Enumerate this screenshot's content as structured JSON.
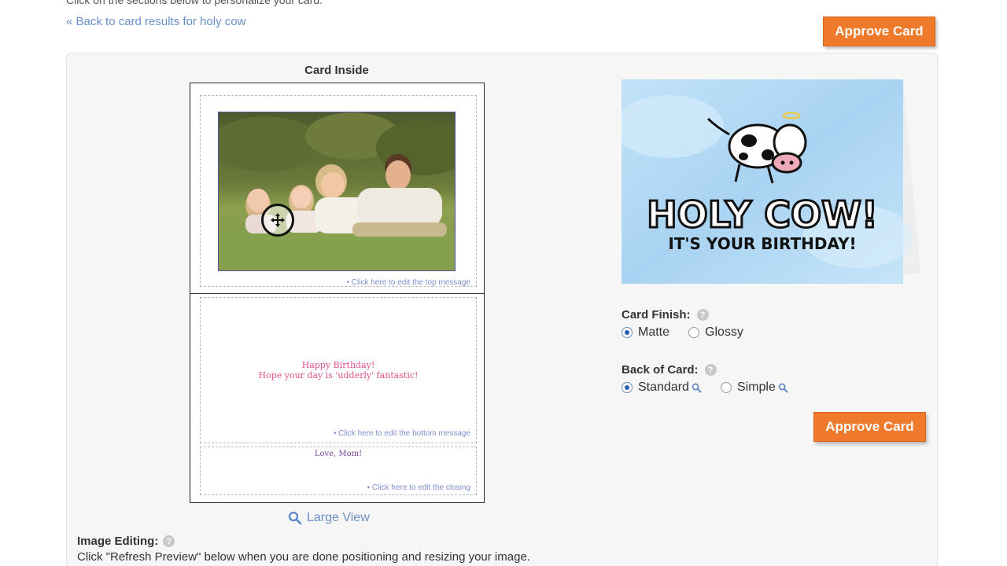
{
  "header": {
    "truncated_text": "Click on the sections below to personalize your card.",
    "back_link": "« Back to card results for holy cow"
  },
  "approve_label": "Approve Card",
  "card_inside": {
    "title": "Card Inside",
    "edit_top": "• Click here to edit the top message",
    "edit_bottom": "• Click here to edit the bottom message",
    "edit_closing": "• Click here to edit the closing",
    "bottom_message_line1": "Happy Birthday!",
    "bottom_message_line2": "Hope your day is 'udderly' fantastic!",
    "closing_message": "Love, Mom!"
  },
  "large_view": "Large View",
  "image_editing": {
    "label": "Image Editing:",
    "help": "?",
    "text": "Click \"Refresh Preview\" below when you are done positioning and resizing your image."
  },
  "card_front": {
    "line1": "HOLY COW!",
    "line2": "IT'S YOUR BIRTHDAY!"
  },
  "options": {
    "finish_label": "Card Finish:",
    "finish_options": [
      "Matte",
      "Glossy"
    ],
    "finish_selected": "Matte",
    "back_label": "Back of Card:",
    "back_options": [
      "Standard",
      "Simple"
    ],
    "back_selected": "Standard",
    "help": "?"
  },
  "colors": {
    "accent": "#f07a2c",
    "link": "#6b8fc7",
    "card_front_bg": "#b7dcf6"
  },
  "icons": [
    "move-cursor-icon",
    "magnifier-icon",
    "help-icon"
  ]
}
